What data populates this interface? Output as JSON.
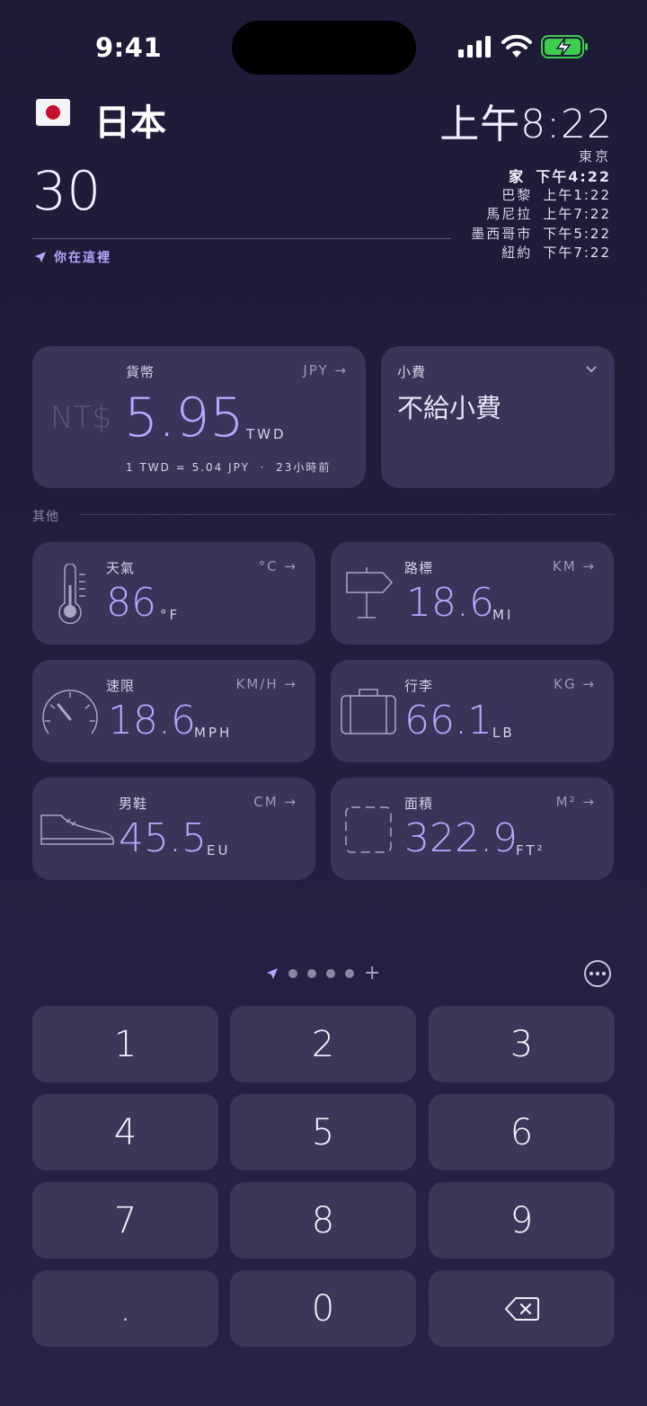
{
  "status_bar": {
    "time": "9:41"
  },
  "location": {
    "flag_icon": "japan-flag",
    "country": "日本",
    "input_value": "30",
    "here_label": "你在這裡"
  },
  "clock": {
    "local_time": "上午8:22",
    "local_city": "東京",
    "cities": [
      {
        "name": "家",
        "time": "下午4:22"
      },
      {
        "name": "巴黎",
        "time": "上午1:22"
      },
      {
        "name": "馬尼拉",
        "time": "上午7:22"
      },
      {
        "name": "墨西哥市",
        "time": "下午5:22"
      },
      {
        "name": "紐約",
        "time": "下午7:22"
      }
    ]
  },
  "currency": {
    "label": "貨幣",
    "from_code": "JPY",
    "symbol": "NT$",
    "value": "5.95",
    "unit": "TWD",
    "rate_text": "1 TWD = 5.04 JPY",
    "separator": "·",
    "updated": "23小時前"
  },
  "tip": {
    "label": "小費",
    "value": "不給小費"
  },
  "others_label": "其他",
  "conversions": {
    "weather": {
      "label": "天氣",
      "alt_unit": "°C",
      "value": "86",
      "unit": "°F",
      "icon": "thermometer-icon"
    },
    "distance": {
      "label": "路標",
      "alt_unit": "KM",
      "value": "18.6",
      "unit": "MI",
      "icon": "signpost-icon"
    },
    "speed": {
      "label": "速限",
      "alt_unit": "KM/H",
      "value": "18.6",
      "unit": "MPH",
      "icon": "speedometer-icon"
    },
    "luggage": {
      "label": "行李",
      "alt_unit": "KG",
      "value": "66.1",
      "unit": "LB",
      "icon": "suitcase-icon"
    },
    "shoes": {
      "label": "男鞋",
      "alt_unit": "CM",
      "value": "45.5",
      "unit": "EU",
      "icon": "shoe-icon"
    },
    "area": {
      "label": "面積",
      "alt_unit": "M²",
      "value": "322.9",
      "unit": "FT²",
      "icon": "area-icon"
    }
  },
  "pager": {
    "add_symbol": "+"
  },
  "keypad": {
    "k1": "1",
    "k2": "2",
    "k3": "3",
    "k4": "4",
    "k5": "5",
    "k6": "6",
    "k7": "7",
    "k8": "8",
    "k9": "9",
    "kdot": ".",
    "k0": "0",
    "kdel_icon": "backspace-icon"
  },
  "colors": {
    "accent": "#b9a6ff",
    "card": "#3a3459",
    "background": "#1d1b36"
  }
}
